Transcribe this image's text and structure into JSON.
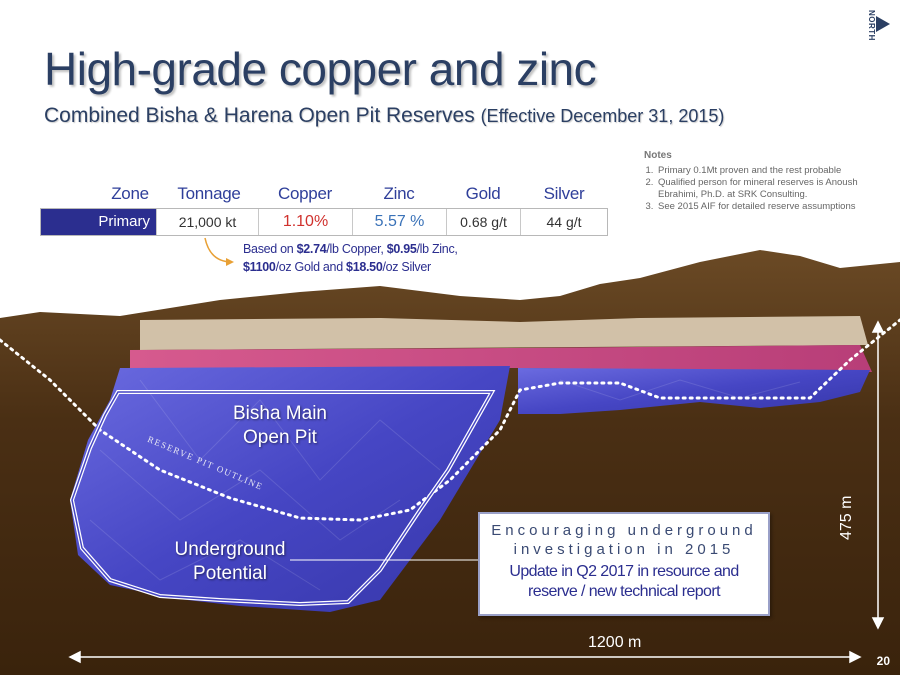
{
  "slide": {
    "title": "High-grade copper and zinc",
    "subtitle_main": "Combined Bisha & Harena Open Pit Reserves",
    "subtitle_effective": "(Effective December 31, 2015)",
    "north_label": "NORTH",
    "page_number": "20"
  },
  "reserves_table": {
    "headers": [
      "Zone",
      "Tonnage",
      "Copper",
      "Zinc",
      "Gold",
      "Silver"
    ],
    "row": {
      "zone": "Primary",
      "tonnage": "21,000 kt",
      "copper": "1.10%",
      "zinc": "5.57 %",
      "gold": "0.68 g/t",
      "silver": "44 g/t"
    }
  },
  "price_basis": {
    "line1_pre": "Based on ",
    "copper_price": "$2.74",
    "line1_mid": "/lb Copper, ",
    "zinc_price": "$0.95",
    "line1_post": "/lb Zinc,",
    "gold_price": "$1100",
    "line2_mid": "/oz Gold and ",
    "silver_price": "$18.50",
    "line2_post": "/oz Silver"
  },
  "notes": {
    "title": "Notes",
    "items": [
      "Primary 0.1Mt proven and the rest probable",
      "Qualified person for mineral reserves is  Anoush Ebrahimi, Ph.D. at SRK Consulting.",
      "See 2015 AIF for detailed reserve assumptions"
    ]
  },
  "cross_section": {
    "pit_label_line1": "Bisha Main",
    "pit_label_line2": "Open Pit",
    "reserve_outline_label": "RESERVE PIT OUTLINE",
    "underground_line1": "Underground",
    "underground_line2": "Potential",
    "width_dimension": "1200 m",
    "depth_dimension": "475 m"
  },
  "callout": {
    "line1": "Encouraging underground",
    "line2": "investigation in 2015",
    "update_line1": "Update in Q2 2017 in resource and",
    "update_line2": "reserve / new technical report"
  },
  "colors": {
    "title": "#2b3f63",
    "table_header": "#2f3f9a",
    "zone_fill": "#2b2e8f",
    "copper_value": "#d0312d",
    "zinc_value": "#3a72b8",
    "ground": "#4a2f14",
    "orebody_blue": "#4b4bc8",
    "orebody_pink": "#c84a82",
    "oxide_cap": "#d8c8b0"
  }
}
